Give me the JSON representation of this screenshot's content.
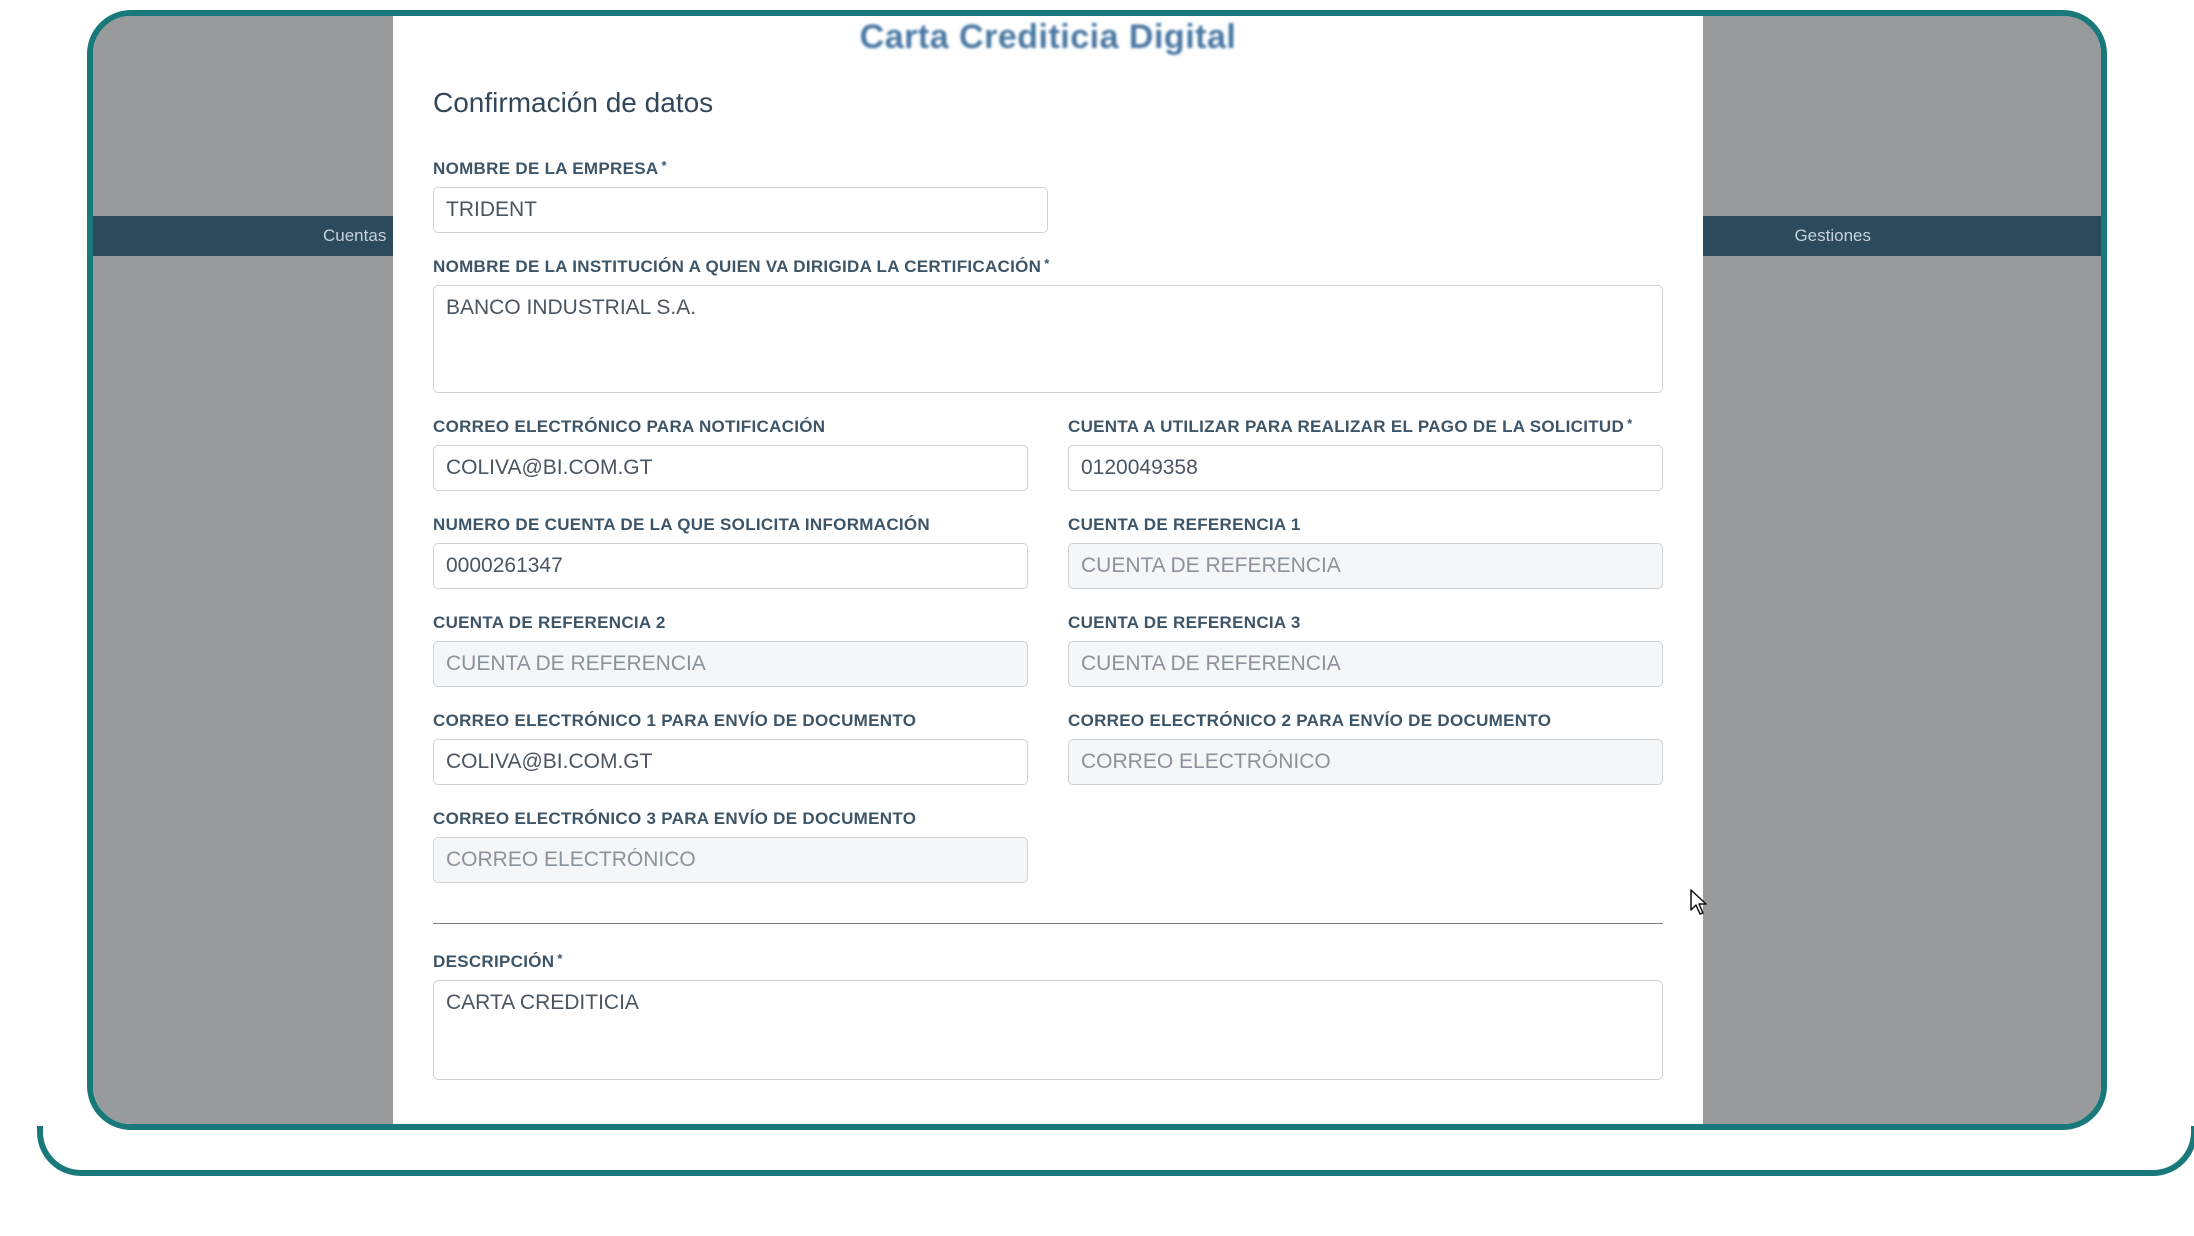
{
  "frame": {
    "nav_left": "Cuentas",
    "nav_right": "Gestiones"
  },
  "modal": {
    "title": "Carta Crediticia Digital",
    "section_title": "Confirmación de datos",
    "fields": {
      "company_label": "NOMBRE DE LA EMPRESA",
      "company_value": "TRIDENT",
      "institution_label": "NOMBRE DE LA INSTITUCIÓN A QUIEN VA DIRIGIDA LA CERTIFICACIÓN",
      "institution_value": "BANCO INDUSTRIAL S.A.",
      "notify_email_label": "CORREO ELECTRÓNICO PARA NOTIFICACIÓN",
      "notify_email_value": "COLIVA@BI.COM.GT",
      "pay_account_label": "CUENTA A UTILIZAR PARA REALIZAR EL PAGO DE LA SOLICITUD",
      "pay_account_value": "0120049358",
      "info_account_label": "NUMERO DE CUENTA DE LA QUE SOLICITA INFORMACIÓN",
      "info_account_value": "0000261347",
      "ref1_label": "CUENTA DE REFERENCIA 1",
      "ref1_value": "",
      "ref1_placeholder": "CUENTA DE REFERENCIA",
      "ref2_label": "CUENTA DE REFERENCIA 2",
      "ref2_value": "",
      "ref2_placeholder": "CUENTA DE REFERENCIA",
      "ref3_label": "CUENTA DE REFERENCIA 3",
      "ref3_value": "",
      "ref3_placeholder": "CUENTA DE REFERENCIA",
      "doc_email1_label": "CORREO ELECTRÓNICO 1 PARA ENVÍO DE DOCUMENTO",
      "doc_email1_value": "COLIVA@BI.COM.GT",
      "doc_email2_label": "CORREO ELECTRÓNICO 2 PARA ENVÍO DE DOCUMENTO",
      "doc_email2_value": "",
      "doc_email2_placeholder": "CORREO ELECTRÓNICO",
      "doc_email3_label": "CORREO ELECTRÓNICO 3 PARA ENVÍO DE DOCUMENTO",
      "doc_email3_value": "",
      "doc_email3_placeholder": "CORREO ELECTRÓNICO",
      "description_label": "DESCRIPCIÓN",
      "description_value": "CARTA CREDITICIA"
    }
  }
}
